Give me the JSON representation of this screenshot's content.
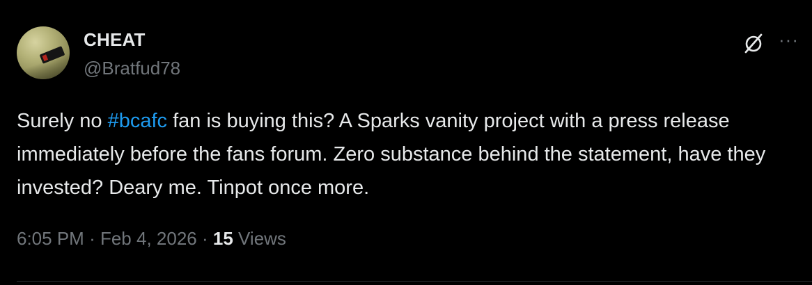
{
  "user": {
    "display_name": "CHEAT",
    "handle": "@Bratfud78",
    "avatar_icon": "avatar-photo"
  },
  "actions": {
    "grok_icon": "grok-slash-circle-icon",
    "more_label": "···"
  },
  "tweet": {
    "text_before": "Surely no ",
    "hashtag": "#bcafc",
    "text_after": " fan is buying this? A Sparks vanity project with a press release immediately before the fans forum. Zero substance behind the statement, have they invested? Deary me. Tinpot once more."
  },
  "meta": {
    "time": "6:05 PM",
    "separator": "·",
    "date": "Feb 4, 2026",
    "views_count": "15",
    "views_label": "Views"
  },
  "colors": {
    "background": "#000000",
    "text_primary": "#e7e9ea",
    "text_secondary": "#71767b",
    "accent": "#1d9bf0",
    "divider": "#2f3336"
  }
}
